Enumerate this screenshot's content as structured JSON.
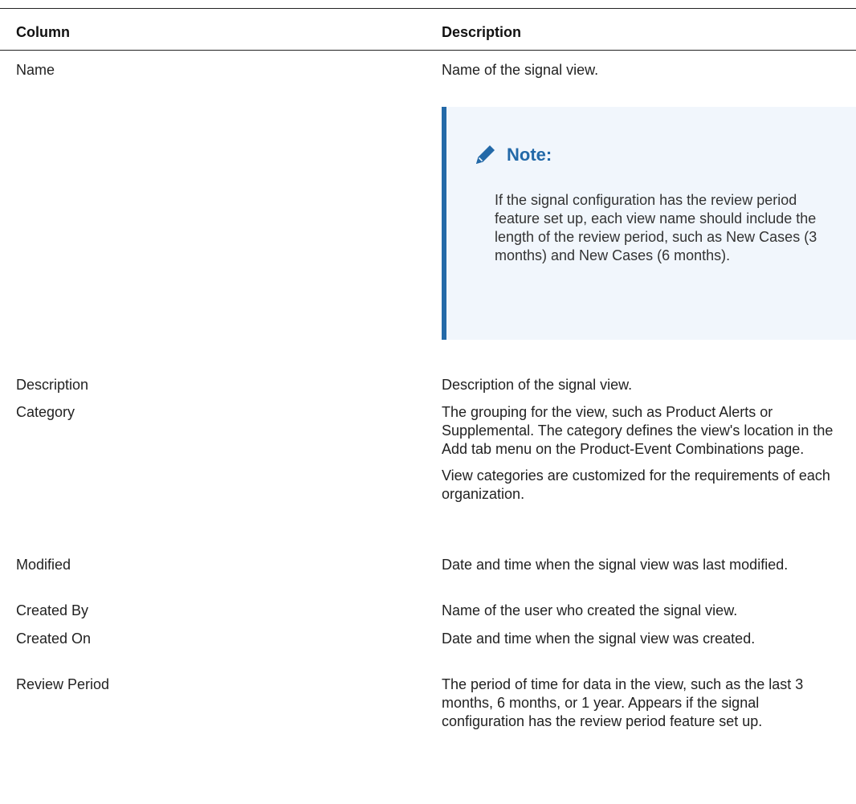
{
  "table": {
    "headers": {
      "column": "Column",
      "description": "Description"
    },
    "rows": [
      {
        "column": "Name",
        "description": [
          "Name of the signal view."
        ],
        "note": {
          "title": "Note:",
          "icon": "pencil-icon",
          "text": "If the signal configuration has the review period feature set up, each view name should include the length of the review period, such as New Cases (3 months) and New Cases (6 months)."
        }
      },
      {
        "column": "Description",
        "description": [
          "Description of the signal view."
        ]
      },
      {
        "column": "Category",
        "description": [
          "The grouping for the view, such as Product Alerts or Supplemental. The category defines the view's location in the Add tab menu on the Product-Event Combinations page.",
          "View categories are customized for the requirements of each organization."
        ]
      },
      {
        "column": "Modified",
        "description": [
          "Date and time when the signal view was last modified."
        ]
      },
      {
        "column": "Created By",
        "description": [
          "Name of the user who created the signal view."
        ]
      },
      {
        "column": "Created On",
        "description": [
          "Date and time when the signal view was created."
        ]
      },
      {
        "column": "Review Period",
        "description": [
          "The period of time for data in the view, such as the last 3 months, 6 months, or 1 year. Appears if the signal configuration has the review period feature set up."
        ]
      }
    ]
  },
  "colors": {
    "text": "#222222",
    "note_accent": "#2369a8",
    "note_background": "#f1f6fc"
  }
}
